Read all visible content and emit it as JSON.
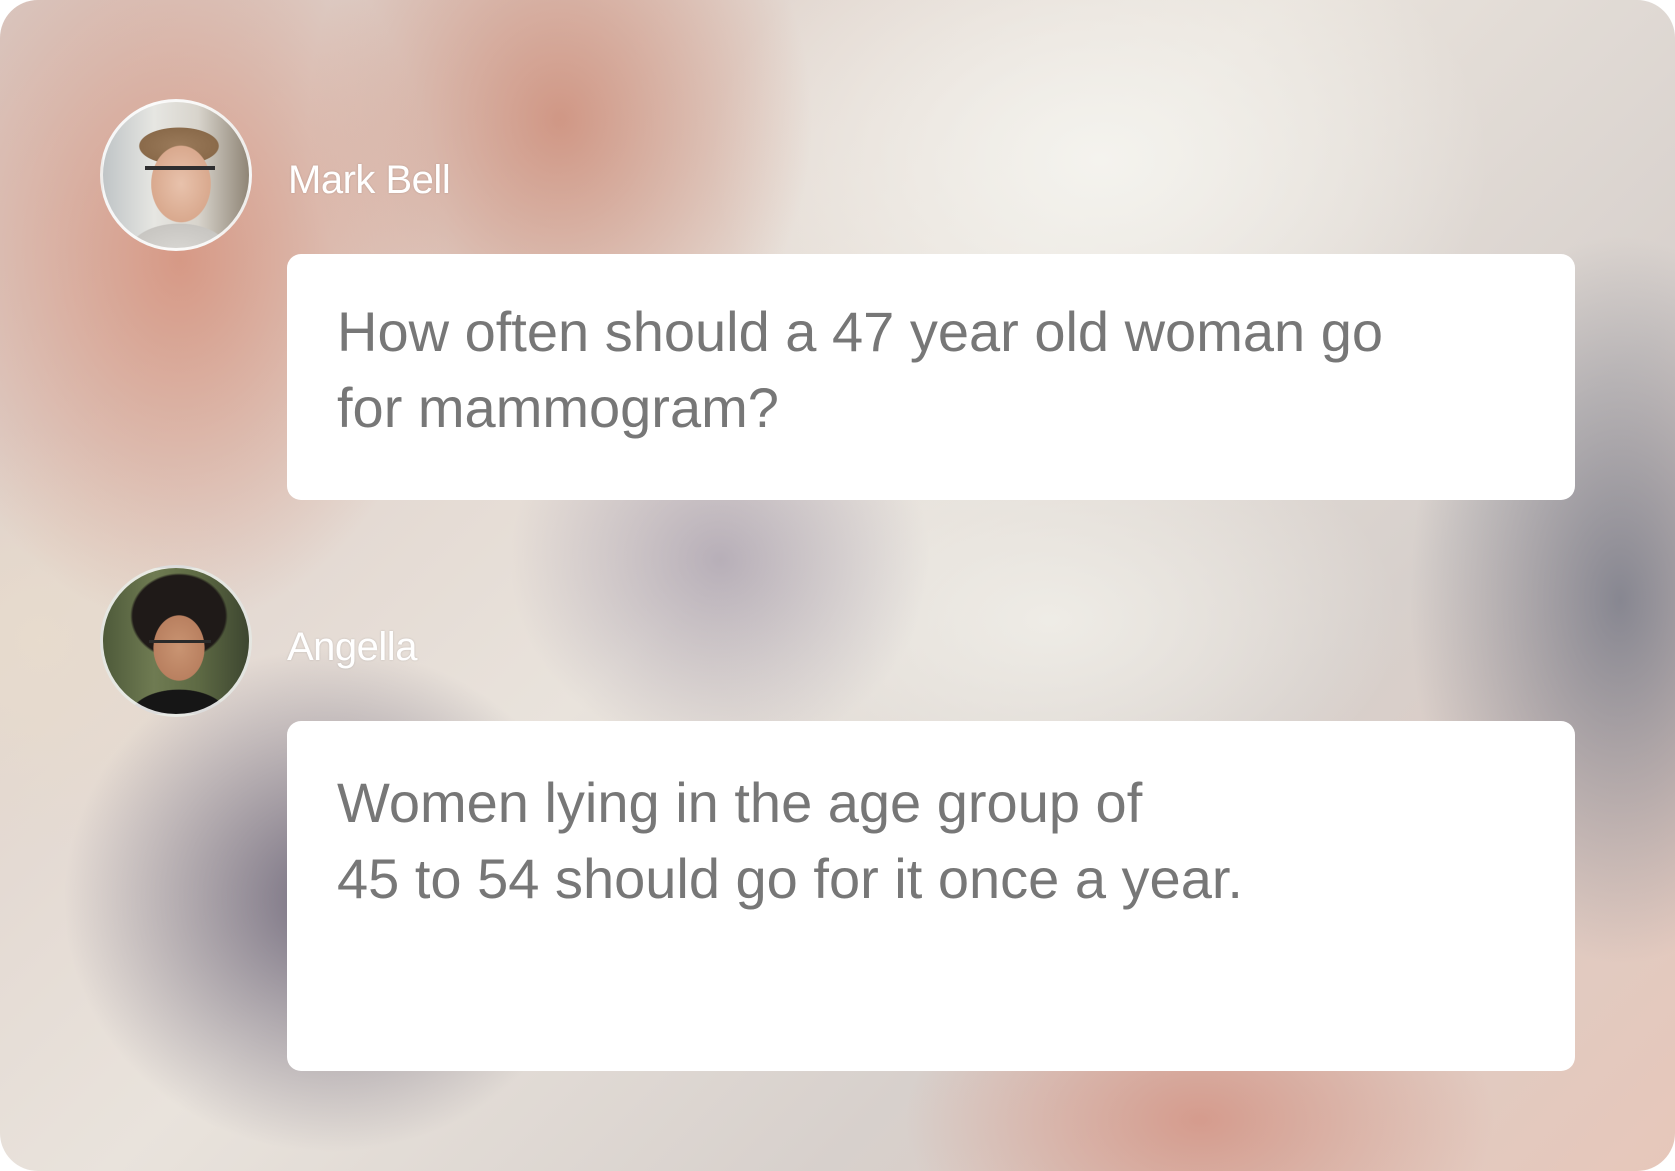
{
  "messages": [
    {
      "sender": "Mark Bell",
      "avatar": "avatar-photo-young-man-glasses",
      "lines": [
        "How often should a 47 year old woman go",
        "for mammogram?"
      ]
    },
    {
      "sender": "Angella",
      "avatar": "avatar-photo-person-curly-hair-glasses",
      "lines": [
        "Women lying in the age group of",
        "45 to 54 should go for it once a year."
      ]
    }
  ],
  "colors": {
    "bubble_background": "#ffffff",
    "message_text": "#777777",
    "sender_name": "#ffffff"
  }
}
